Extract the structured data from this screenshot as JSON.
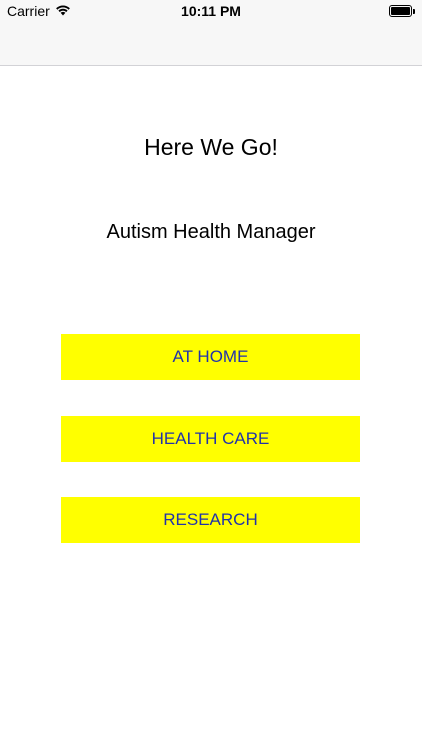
{
  "status_bar": {
    "carrier": "Carrier",
    "time": "10:11 PM",
    "battery_level": 1.0
  },
  "main": {
    "headline": "Here We Go!",
    "subtitle": "Autism Health Manager",
    "buttons": [
      {
        "label": "AT HOME"
      },
      {
        "label": "HEALTH CARE"
      },
      {
        "label": "RESEARCH"
      }
    ]
  },
  "colors": {
    "button_background": "#ffff00",
    "button_text": "#2233aa",
    "bar_background": "#f7f7f7"
  }
}
